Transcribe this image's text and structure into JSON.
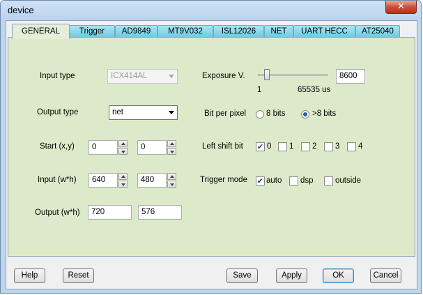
{
  "window": {
    "title": "device",
    "close_glyph": "✕"
  },
  "tabs": [
    {
      "label": "GENERAL",
      "active": true
    },
    {
      "label": "Trigger"
    },
    {
      "label": "AD9849"
    },
    {
      "label": "MT9V032"
    },
    {
      "label": "ISL12026"
    },
    {
      "label": "NET"
    },
    {
      "label": "UART HECC"
    },
    {
      "label": "AT25040"
    }
  ],
  "general": {
    "input_type": {
      "label": "Input type",
      "value": "ICX414AL",
      "disabled": true
    },
    "output_type": {
      "label": "Output type",
      "value": "net"
    },
    "start": {
      "label": "Start (x,y)",
      "x": "0",
      "y": "0"
    },
    "input_size": {
      "label": "Input (w*h)",
      "w": "640",
      "h": "480"
    },
    "output_size": {
      "label": "Output (w*h)",
      "w": "720",
      "h": "576"
    },
    "exposure": {
      "label": "Exposure V.",
      "value": "8600",
      "min_label": "1",
      "max_label": "65535 us",
      "min": 1,
      "max": 65535
    },
    "bit_per_pixel": {
      "label": "Bit per pixel",
      "options": [
        {
          "label": "8 bits",
          "selected": false
        },
        {
          "label": ">8 bits",
          "selected": true
        }
      ]
    },
    "left_shift": {
      "label": "Left shift bit",
      "options": [
        {
          "label": "0",
          "checked": true
        },
        {
          "label": "1",
          "checked": false
        },
        {
          "label": "2",
          "checked": false
        },
        {
          "label": "3",
          "checked": false
        },
        {
          "label": "4",
          "checked": false
        }
      ]
    },
    "trigger_mode": {
      "label": "Trigger mode",
      "options": [
        {
          "label": "auto",
          "checked": true
        },
        {
          "label": "dsp",
          "checked": false
        },
        {
          "label": "outside",
          "checked": false
        }
      ]
    }
  },
  "buttons": {
    "help": "Help",
    "reset": "Reset",
    "save": "Save",
    "apply": "Apply",
    "ok": "OK",
    "cancel": "Cancel"
  },
  "check_glyph": "✔"
}
